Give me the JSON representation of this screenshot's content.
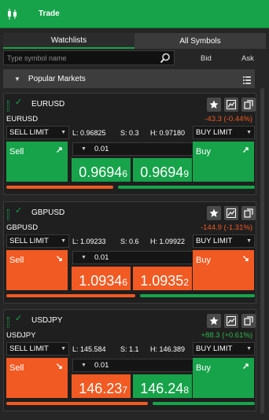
{
  "header": {
    "title": "Trade",
    "icon": "candlestick-icon",
    "color": "#17a34a"
  },
  "tabs": [
    {
      "label": "Watchlists",
      "active": true
    },
    {
      "label": "All Symbols",
      "active": false
    }
  ],
  "search": {
    "placeholder": "Type symbol name",
    "icon": "search-icon"
  },
  "columns": {
    "bid": "Bid",
    "ask": "Ask"
  },
  "section": {
    "label": "Popular Markets",
    "icon": "list-menu-icon"
  },
  "instruments": [
    {
      "symbol": "EURUSD",
      "name": "EURUSD",
      "change": "-43.3 (-0.44%)",
      "direction": "neg",
      "sell_limit": "SELL LIMIT",
      "buy_limit": "BUY LIMIT",
      "low": "L: 0.96825",
      "spread": "S: 0.3",
      "high": "H: 0.97180",
      "quantity": "0.01",
      "sell_label": "Sell",
      "buy_label": "Buy",
      "sell_color": "green",
      "buy_color": "green",
      "sell_arrow": "↗",
      "buy_arrow": "↗",
      "sell_price_main": "0.9694",
      "sell_price_pip": "6",
      "buy_price_main": "0.9694",
      "buy_price_pip": "9",
      "sentiment_sell_pct": 0.44
    },
    {
      "symbol": "GBPUSD",
      "name": "GBPUSD",
      "change": "-144.9 (-1.31%)",
      "direction": "neg",
      "sell_limit": "SELL LIMIT",
      "buy_limit": "BUY LIMIT",
      "low": "L: 1.09233",
      "spread": "S: 0.6",
      "high": "H: 1.09922",
      "quantity": "0.01",
      "sell_label": "Sell",
      "buy_label": "Buy",
      "sell_color": "orange",
      "buy_color": "orange",
      "sell_arrow": "↘",
      "buy_arrow": "↘",
      "sell_price_main": "1.0934",
      "sell_price_pip": "6",
      "buy_price_main": "1.0935",
      "buy_price_pip": "2",
      "sentiment_sell_pct": 0.53
    },
    {
      "symbol": "USDJPY",
      "name": "USDJPY",
      "change": "+88.3 (+0.61%)",
      "direction": "pos",
      "sell_limit": "SELL LIMIT",
      "buy_limit": "BUY LIMIT",
      "low": "L: 145.584",
      "spread": "S: 1.1",
      "high": "H: 146.389",
      "quantity": "0.01",
      "sell_label": "Sell",
      "buy_label": "Buy",
      "sell_color": "orange",
      "buy_color": "green",
      "sell_arrow": "↘",
      "buy_arrow": "↗",
      "sell_price_main": "146.23",
      "sell_price_pip": "7",
      "buy_price_main": "146.24",
      "buy_price_pip": "8",
      "sentiment_sell_pct": 0.58
    }
  ]
}
